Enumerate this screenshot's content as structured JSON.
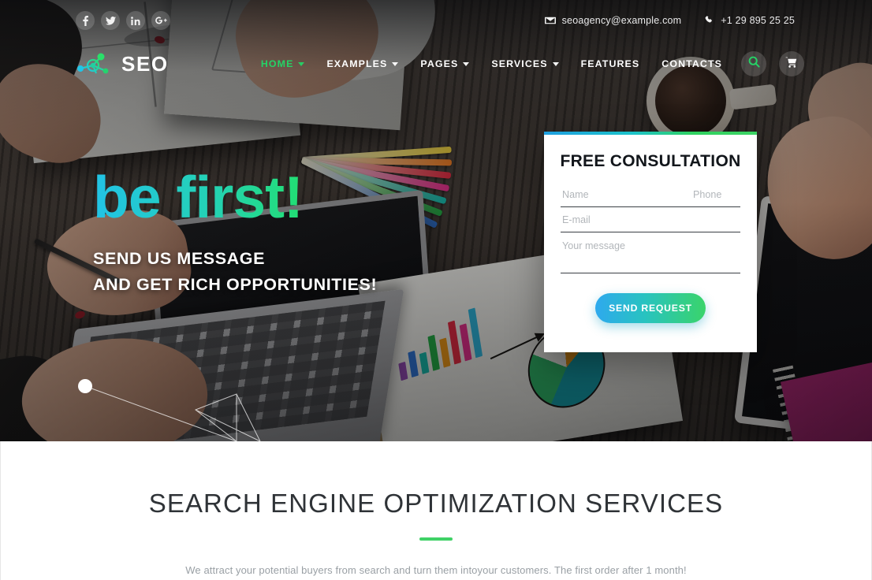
{
  "topbar": {
    "socials": [
      {
        "name": "facebook",
        "label": "f"
      },
      {
        "name": "twitter",
        "label": "t"
      },
      {
        "name": "linkedin",
        "label": "in"
      },
      {
        "name": "googleplus",
        "label": "g+"
      }
    ],
    "email": "seoagency@example.com",
    "phone": "+1 29 895 25 25"
  },
  "brand": {
    "text": "SEO"
  },
  "nav": {
    "items": [
      {
        "label": "HOME",
        "active": true,
        "caret": true
      },
      {
        "label": "EXAMPLES",
        "active": false,
        "caret": true
      },
      {
        "label": "PAGES",
        "active": false,
        "caret": true
      },
      {
        "label": "SERVICES",
        "active": false,
        "caret": true
      },
      {
        "label": "FEATURES",
        "active": false,
        "caret": false
      },
      {
        "label": "CONTACTS",
        "active": false,
        "caret": false
      }
    ]
  },
  "hero": {
    "headline": "be first!",
    "line1": "SEND US MESSAGE",
    "line2": "AND GET RICH OPPORTUNITIES!"
  },
  "form": {
    "title": "FREE CONSULTATION",
    "name_placeholder": "Name",
    "phone_placeholder": "Phone",
    "email_placeholder": "E-mail",
    "message_placeholder": "Your message",
    "name_value": "",
    "phone_value": "",
    "email_value": "",
    "message_value": "",
    "submit_label": "SEND REQUEST"
  },
  "services": {
    "title": "SEARCH ENGINE OPTIMIZATION SERVICES",
    "subtitle": "We attract your potential buyers from search and turn them intoyour customers. The first order after 1 month!"
  },
  "colors": {
    "accent_green": "#3fd166",
    "accent_cyan": "#22c3e6",
    "nav_active": "#25d366",
    "gradient_start": "#2ea9ee",
    "gradient_end": "#3ad46a",
    "heading_dark": "#2f3337",
    "muted_text": "#9aa0a5"
  }
}
